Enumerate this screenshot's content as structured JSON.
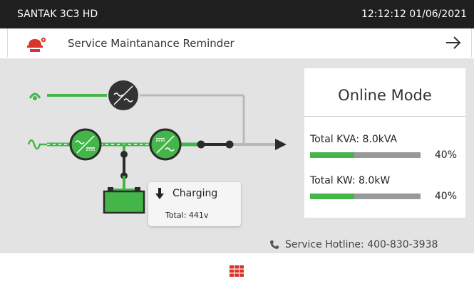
{
  "header": {
    "device_name": "SANTAK 3C3 HD",
    "datetime": "12:12:12 01/06/2021"
  },
  "notice": {
    "icon": "maintenance-worker-icon",
    "text": "Service Maintanance Reminder",
    "action_icon": "arrow-right-icon"
  },
  "mode": {
    "label": "Online Mode"
  },
  "stats": [
    {
      "label": "Total KVA: 8.0kVA",
      "percent_text": "40%",
      "level": 40
    },
    {
      "label": "Total KW: 8.0kW",
      "percent_text": "40%",
      "level": 40
    }
  ],
  "battery": {
    "state": "Charging",
    "total": "Total:  441v"
  },
  "hotline": {
    "text": "Service Hotline: 400-830-3938"
  },
  "colors": {
    "accent_green": "#43b549",
    "dark_gray": "#333333",
    "alert_red": "#d9332a"
  }
}
